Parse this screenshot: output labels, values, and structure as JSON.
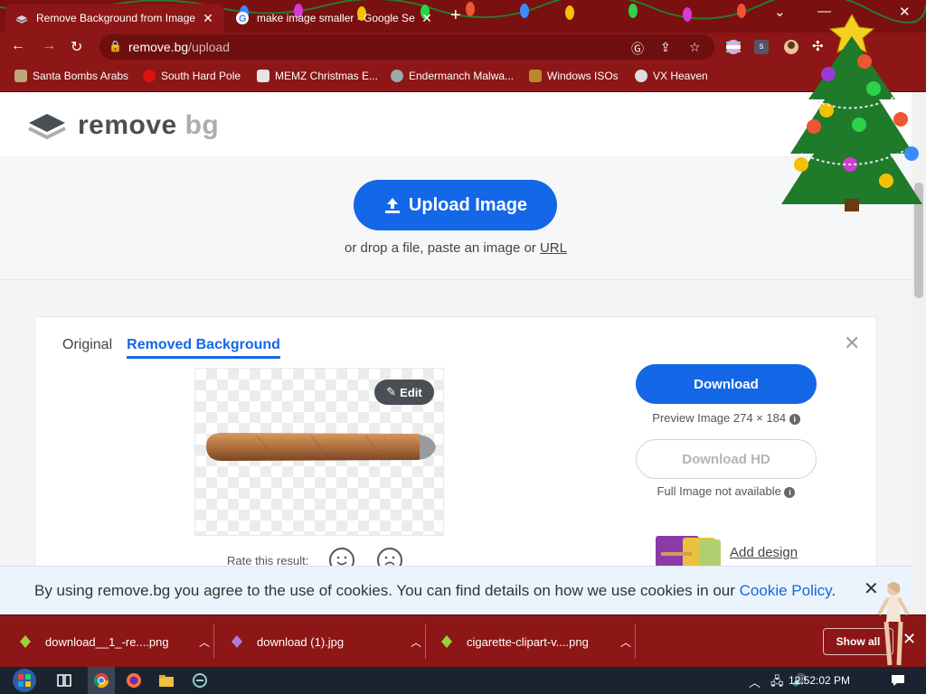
{
  "browser": {
    "tabs": [
      {
        "title": "Remove Background from Image",
        "active": true
      },
      {
        "title": "make image smaller - Google Se",
        "active": false
      }
    ],
    "new_tab": "+",
    "url_host": "remove.bg",
    "url_path": "/upload",
    "bookmarks": [
      {
        "label": "Santa Bombs Arabs",
        "color": "#c2a57a"
      },
      {
        "label": "South Hard Pole",
        "color": "#d11"
      },
      {
        "label": "MEMZ Christmas E...",
        "color": "#e5e5e5"
      },
      {
        "label": "Endermanch Malwa...",
        "color": "#9aa"
      },
      {
        "label": "Windows ISOs",
        "color": "#b88a2a"
      },
      {
        "label": "VX Heaven",
        "color": "#ddd"
      }
    ]
  },
  "site": {
    "logo_text_a": "remove",
    "logo_text_b": "bg",
    "upload_label": "Upload Image",
    "drop_hint_prefix": "or drop a file, paste an image or ",
    "drop_hint_link": "URL",
    "tab_original": "Original",
    "tab_removed": "Removed Background",
    "edit_label": "Edit",
    "rate_label": "Rate this result:",
    "download_label": "Download",
    "preview_info": "Preview Image 274 × 184",
    "download_hd_label": "Download HD",
    "full_info": "Full Image not available",
    "add_design_label": "Add design",
    "cookie_text": "By using remove.bg you agree to the use of cookies. You can find details on how we use cookies in our ",
    "cookie_link": "Cookie Policy",
    "cookie_end": ".",
    "accent": "#1467e6"
  },
  "downloads": {
    "items": [
      {
        "name": "download__1_-re....png"
      },
      {
        "name": "download (1).jpg"
      },
      {
        "name": "cigarette-clipart-v....png"
      }
    ],
    "show_all": "Show all"
  },
  "taskbar": {
    "time": "12:52:02 PM"
  }
}
